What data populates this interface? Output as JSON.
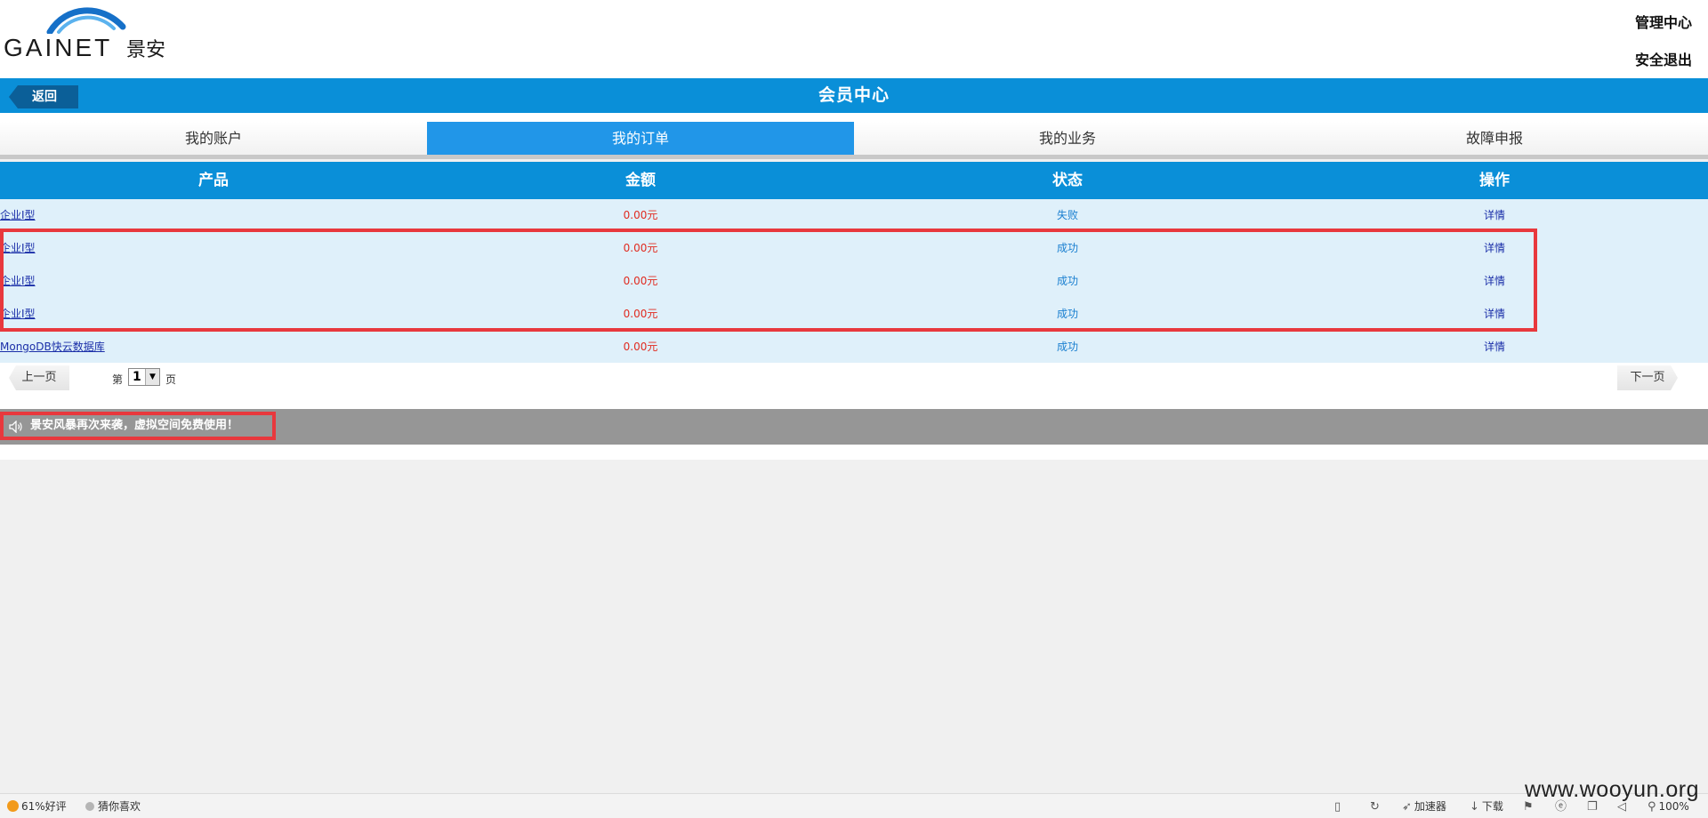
{
  "header": {
    "logo_text": "GAINET",
    "logo_cn": "景安",
    "admin_link": "管理中心",
    "logout_link": "安全退出"
  },
  "titlebar": {
    "back_label": "返回",
    "title": "会员中心"
  },
  "tabs": [
    {
      "label": "我的账户",
      "active": false
    },
    {
      "label": "我的订单",
      "active": true
    },
    {
      "label": "我的业务",
      "active": false
    },
    {
      "label": "故障申报",
      "active": false
    }
  ],
  "orders": {
    "columns": [
      "产品",
      "金额",
      "状态",
      "操作"
    ],
    "rows": [
      {
        "product": "企业I型",
        "amount": "0.00元",
        "status": "失败",
        "action": "详情"
      },
      {
        "product": "企业I型",
        "amount": "0.00元",
        "status": "成功",
        "action": "详情"
      },
      {
        "product": "企业I型",
        "amount": "0.00元",
        "status": "成功",
        "action": "详情"
      },
      {
        "product": "企业I型",
        "amount": "0.00元",
        "status": "成功",
        "action": "详情"
      },
      {
        "product": "MongoDB快云数据库",
        "amount": "0.00元",
        "status": "成功",
        "action": "详情"
      }
    ]
  },
  "pager": {
    "prev_label": "上一页",
    "next_label": "下一页",
    "prefix": "第",
    "current_page": "1",
    "suffix": "页"
  },
  "notice": {
    "text": "景安风暴再次来袭，虚拟空间免费使用！"
  },
  "statusbar": {
    "rating": "61%好评",
    "guess": "猜你喜欢",
    "accelerator": "加速器",
    "download": "下载",
    "zoom": "100%"
  },
  "watermark": "www.wooyun.org",
  "colors": {
    "brand_blue": "#0a8fd8",
    "active_tab": "#2196e8",
    "amount_red": "#e02b20",
    "highlight_red": "#e8383d"
  }
}
